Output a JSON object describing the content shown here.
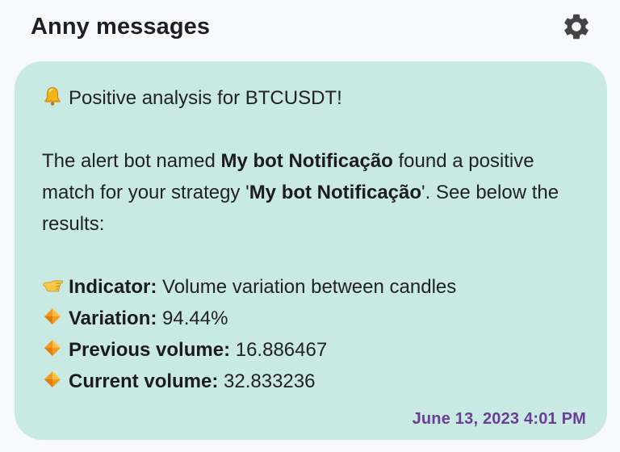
{
  "header": {
    "title": "Anny messages",
    "settings_icon": "gear-icon"
  },
  "message": {
    "line1": "Positive analysis for BTCUSDT!",
    "intro_prefix": "The alert bot named ",
    "bot_name": "My bot Notificação",
    "intro_middle": " found a positive match for your strategy '",
    "strategy_name": "My bot Notificação",
    "intro_suffix": "'. See below the results:",
    "indicator_label": "Indicator:",
    "indicator_value": " Volume variation between candles",
    "variation_label": "Variation:",
    "variation_value": " 94.44%",
    "previous_label": "Previous volume:",
    "previous_value": " 16.886467",
    "current_label": "Current volume:",
    "current_value": " 32.833236",
    "timestamp": "June 13, 2023 4:01 PM",
    "icons": {
      "alert": "bell-icon",
      "indicator": "pointing-hand-icon",
      "bullet": "orange-diamond-icon"
    }
  },
  "colors": {
    "bubble_background": "#c9eae2",
    "timestamp": "#6a3d96",
    "page_background": "#f8f9fc",
    "gear": "#444444"
  }
}
